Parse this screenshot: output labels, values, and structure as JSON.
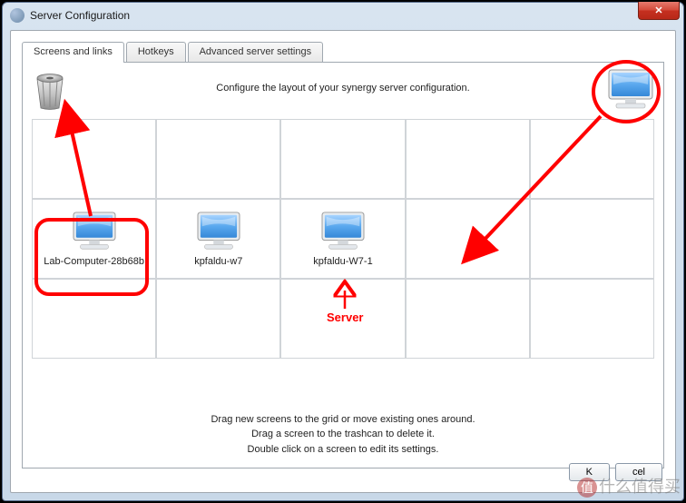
{
  "window": {
    "title": "Server Configuration"
  },
  "tabs": {
    "screens": "Screens and links",
    "hotkeys": "Hotkeys",
    "advanced": "Advanced server settings"
  },
  "hint_top": "Configure the layout of your synergy server configuration.",
  "grid": {
    "cells": [
      {
        "label": "Lab-Computer-28b68b"
      },
      {
        "label": "kpfaldu-w7"
      },
      {
        "label": "kpfaldu-W7-1"
      }
    ]
  },
  "hint_bottom": {
    "line1": "Drag new screens to the grid or move existing ones around.",
    "line2": "Drag a screen to the trashcan to delete it.",
    "line3": "Double click on a screen to edit its settings."
  },
  "buttons": {
    "ok": "K",
    "cancel": "cel"
  },
  "annotations": {
    "server": "Server"
  },
  "icons": {
    "trash": "trash-icon",
    "monitor": "monitor-icon",
    "close": "close-icon"
  }
}
